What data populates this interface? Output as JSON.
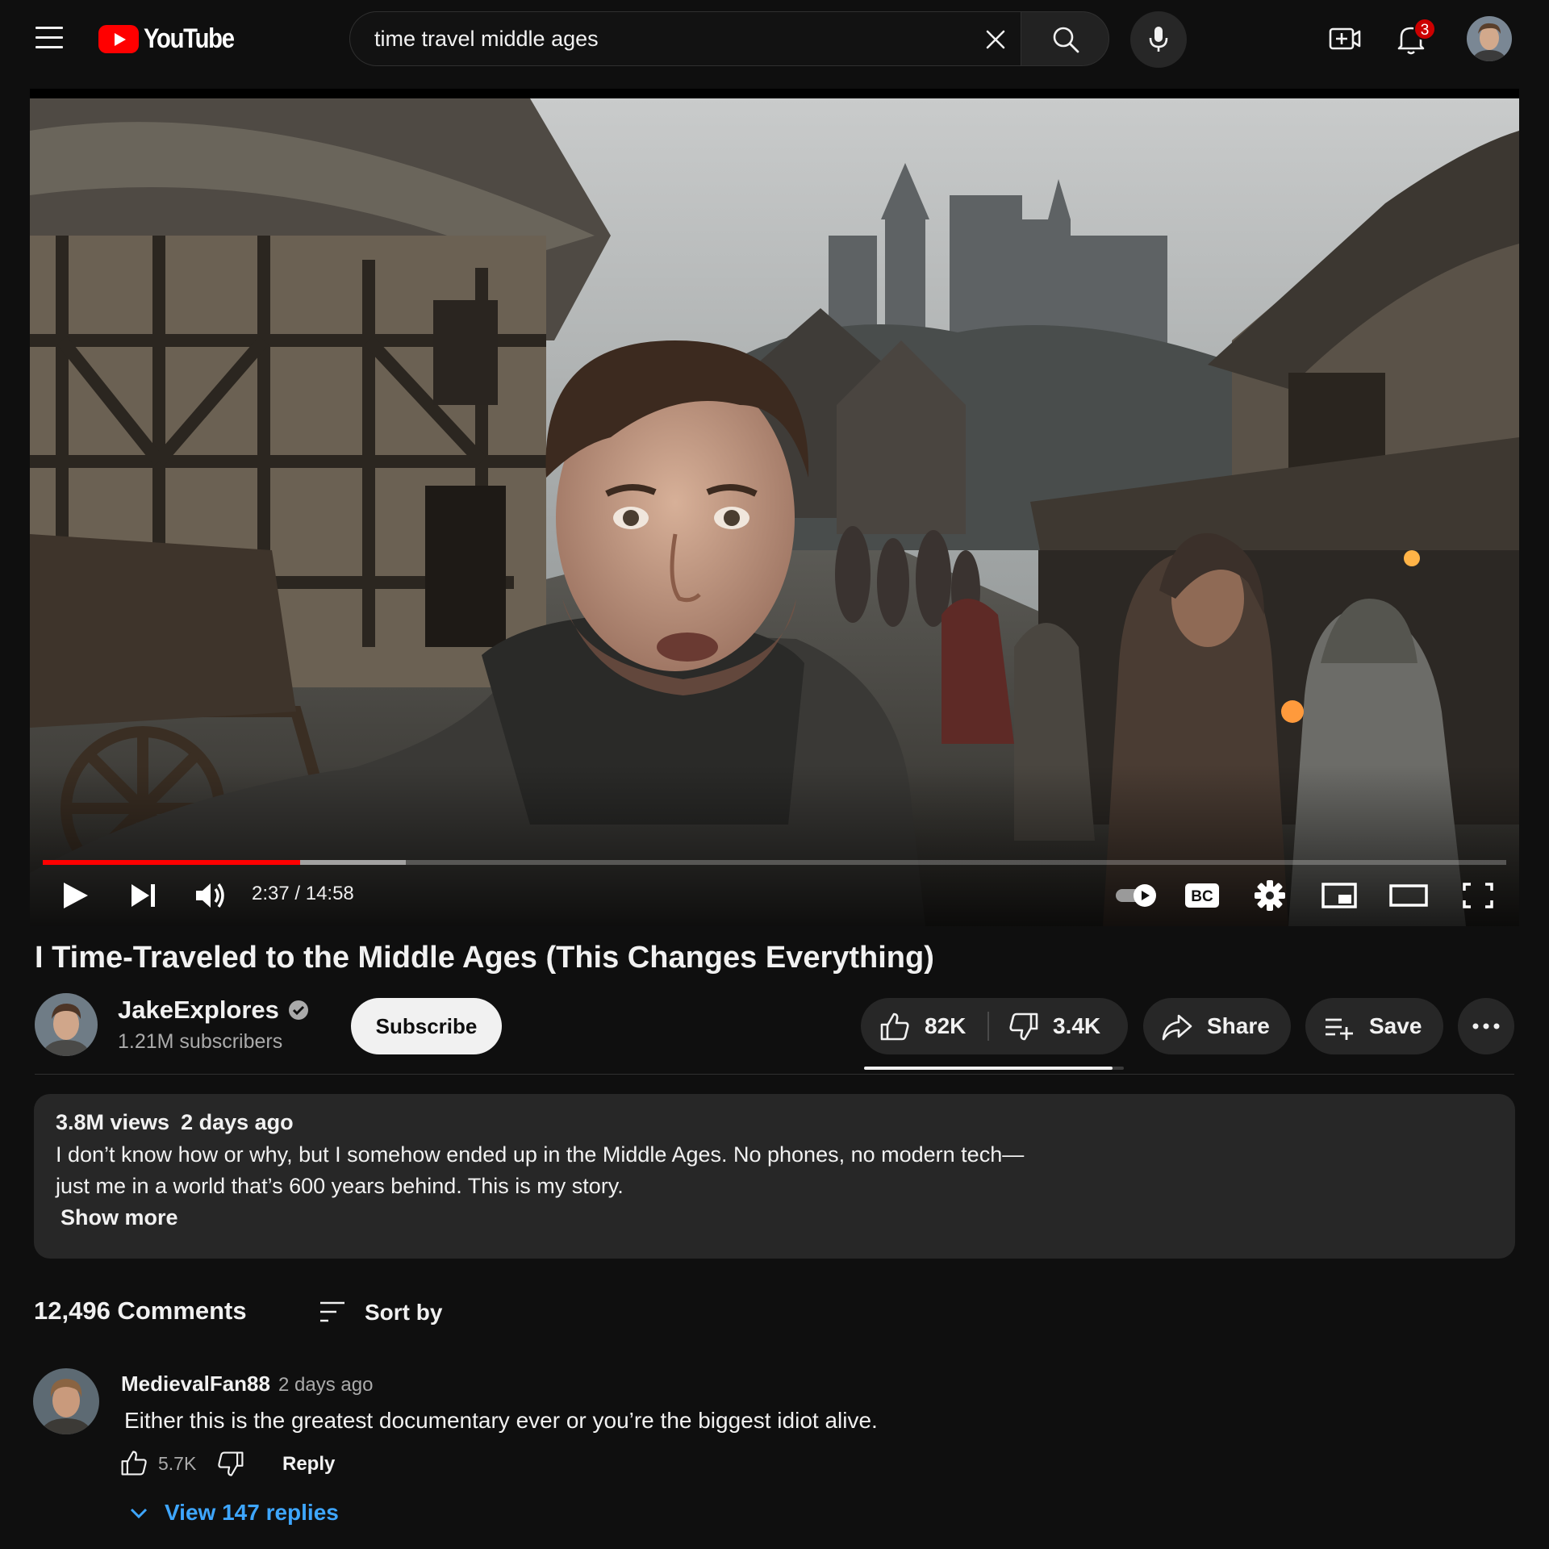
{
  "header": {
    "logo_text": "YouTube",
    "search_value": "time travel middle ages",
    "notification_count": "3"
  },
  "player": {
    "time": "2:37 / 14:58",
    "progress_fraction": 0.176,
    "buffer_fraction": 0.248,
    "controls": [
      "play-icon",
      "next-icon",
      "volume-icon",
      "autoplay-toggle",
      "captions-icon",
      "settings-icon",
      "miniplayer-icon",
      "theater-icon",
      "fullscreen-icon"
    ],
    "captions_label": "BC"
  },
  "video": {
    "title": "I Time-Traveled to the Middle Ages (This Changes Everything)"
  },
  "channel": {
    "name": "JakeExplores",
    "subscribers": "1.21M subscribers",
    "subscribe_label": "Subscribe"
  },
  "actions": {
    "likes": "82K",
    "dislikes": "3.4K",
    "share_label": "Share",
    "save_label": "Save"
  },
  "description": {
    "views": "3.8M views",
    "date": "2 days ago",
    "line1": "I don’t know how or why, but I somehow ended up in the Middle Ages. No phones, no modern tech—",
    "line2": "just me in a world that’s 600 years behind. This is my story.",
    "show_more": "Show more"
  },
  "comments": {
    "count": "12,496 Comments",
    "sort_label": "Sort by",
    "items": [
      {
        "author": "MedievalFan88",
        "time": "2 days ago",
        "text": "Either this is the greatest documentary ever or you’re the biggest idiot alive.",
        "likes": "5.7K",
        "reply_label": "Reply",
        "view_replies": "View 147 replies"
      }
    ]
  },
  "colors": {
    "background": "#0f0f0f",
    "accent_red": "#ff0000",
    "link_blue": "#3ea6ff",
    "pill_bg": "#272727"
  }
}
